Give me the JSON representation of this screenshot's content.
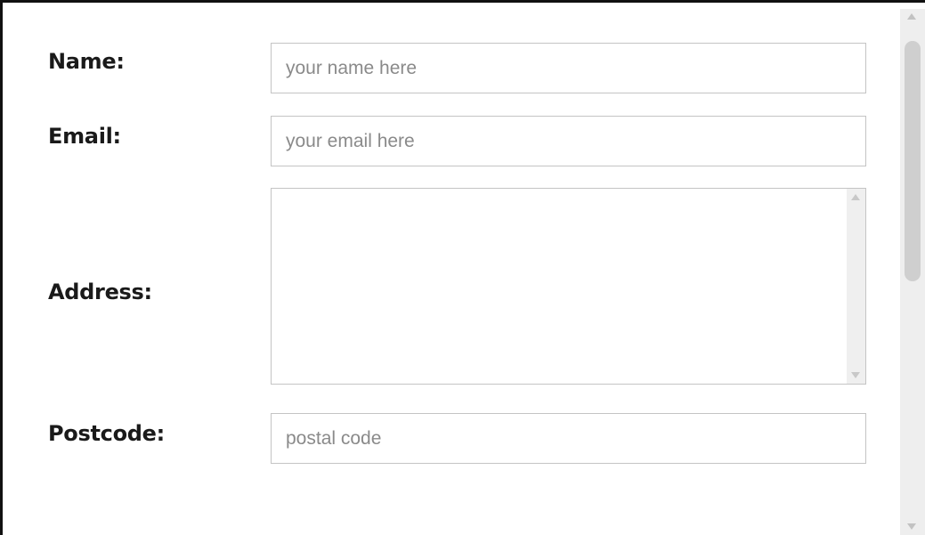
{
  "form": {
    "name": {
      "label": "Name:",
      "placeholder": "your name here",
      "value": ""
    },
    "email": {
      "label": "Email:",
      "placeholder": "your email here",
      "value": ""
    },
    "address": {
      "label": "Address:",
      "value": ""
    },
    "postcode": {
      "label": "Postcode:",
      "placeholder": "postal code",
      "value": ""
    }
  },
  "icons": {
    "scroll_up": "triangle-up-icon",
    "scroll_down": "triangle-down-icon"
  },
  "colors": {
    "frame_border": "#111111",
    "field_border": "#c4c4c4",
    "placeholder_text": "#8a8a8a",
    "scrollbar_track": "#eeeeee",
    "scrollbar_thumb": "#cfcfcf"
  }
}
